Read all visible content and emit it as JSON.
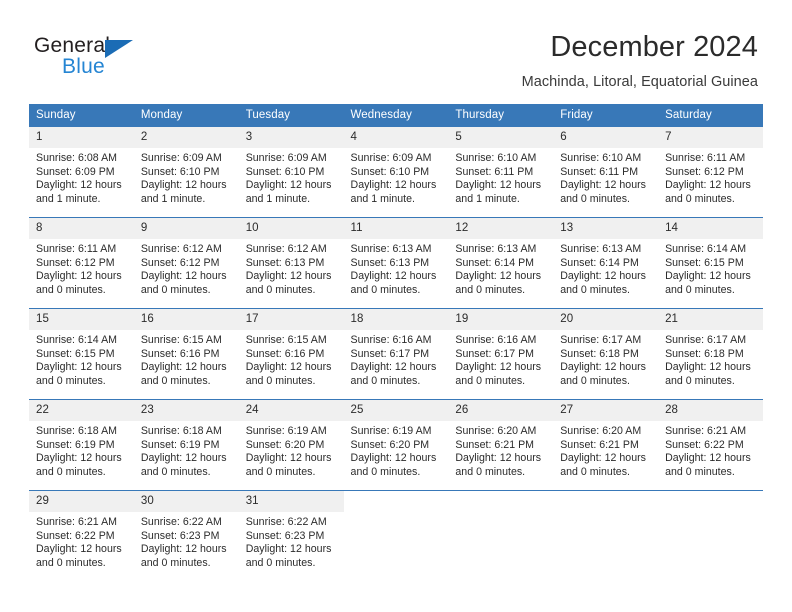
{
  "brand": {
    "name_dark": "General",
    "name_blue": "Blue",
    "accent_color": "#2585d3",
    "triangle_color": "#1b6cb5"
  },
  "header": {
    "title": "December 2024",
    "subtitle": "Machinda, Litoral, Equatorial Guinea"
  },
  "calendar": {
    "header_bg": "#3878b8",
    "daynum_bg": "#f0f0f0",
    "weekday_headers": [
      "Sunday",
      "Monday",
      "Tuesday",
      "Wednesday",
      "Thursday",
      "Friday",
      "Saturday"
    ],
    "weeks": [
      [
        {
          "day": "1",
          "sunrise": "Sunrise: 6:08 AM",
          "sunset": "Sunset: 6:09 PM",
          "daylight_line1": "Daylight: 12 hours",
          "daylight_line2": "and 1 minute."
        },
        {
          "day": "2",
          "sunrise": "Sunrise: 6:09 AM",
          "sunset": "Sunset: 6:10 PM",
          "daylight_line1": "Daylight: 12 hours",
          "daylight_line2": "and 1 minute."
        },
        {
          "day": "3",
          "sunrise": "Sunrise: 6:09 AM",
          "sunset": "Sunset: 6:10 PM",
          "daylight_line1": "Daylight: 12 hours",
          "daylight_line2": "and 1 minute."
        },
        {
          "day": "4",
          "sunrise": "Sunrise: 6:09 AM",
          "sunset": "Sunset: 6:10 PM",
          "daylight_line1": "Daylight: 12 hours",
          "daylight_line2": "and 1 minute."
        },
        {
          "day": "5",
          "sunrise": "Sunrise: 6:10 AM",
          "sunset": "Sunset: 6:11 PM",
          "daylight_line1": "Daylight: 12 hours",
          "daylight_line2": "and 1 minute."
        },
        {
          "day": "6",
          "sunrise": "Sunrise: 6:10 AM",
          "sunset": "Sunset: 6:11 PM",
          "daylight_line1": "Daylight: 12 hours",
          "daylight_line2": "and 0 minutes."
        },
        {
          "day": "7",
          "sunrise": "Sunrise: 6:11 AM",
          "sunset": "Sunset: 6:12 PM",
          "daylight_line1": "Daylight: 12 hours",
          "daylight_line2": "and 0 minutes."
        }
      ],
      [
        {
          "day": "8",
          "sunrise": "Sunrise: 6:11 AM",
          "sunset": "Sunset: 6:12 PM",
          "daylight_line1": "Daylight: 12 hours",
          "daylight_line2": "and 0 minutes."
        },
        {
          "day": "9",
          "sunrise": "Sunrise: 6:12 AM",
          "sunset": "Sunset: 6:12 PM",
          "daylight_line1": "Daylight: 12 hours",
          "daylight_line2": "and 0 minutes."
        },
        {
          "day": "10",
          "sunrise": "Sunrise: 6:12 AM",
          "sunset": "Sunset: 6:13 PM",
          "daylight_line1": "Daylight: 12 hours",
          "daylight_line2": "and 0 minutes."
        },
        {
          "day": "11",
          "sunrise": "Sunrise: 6:13 AM",
          "sunset": "Sunset: 6:13 PM",
          "daylight_line1": "Daylight: 12 hours",
          "daylight_line2": "and 0 minutes."
        },
        {
          "day": "12",
          "sunrise": "Sunrise: 6:13 AM",
          "sunset": "Sunset: 6:14 PM",
          "daylight_line1": "Daylight: 12 hours",
          "daylight_line2": "and 0 minutes."
        },
        {
          "day": "13",
          "sunrise": "Sunrise: 6:13 AM",
          "sunset": "Sunset: 6:14 PM",
          "daylight_line1": "Daylight: 12 hours",
          "daylight_line2": "and 0 minutes."
        },
        {
          "day": "14",
          "sunrise": "Sunrise: 6:14 AM",
          "sunset": "Sunset: 6:15 PM",
          "daylight_line1": "Daylight: 12 hours",
          "daylight_line2": "and 0 minutes."
        }
      ],
      [
        {
          "day": "15",
          "sunrise": "Sunrise: 6:14 AM",
          "sunset": "Sunset: 6:15 PM",
          "daylight_line1": "Daylight: 12 hours",
          "daylight_line2": "and 0 minutes."
        },
        {
          "day": "16",
          "sunrise": "Sunrise: 6:15 AM",
          "sunset": "Sunset: 6:16 PM",
          "daylight_line1": "Daylight: 12 hours",
          "daylight_line2": "and 0 minutes."
        },
        {
          "day": "17",
          "sunrise": "Sunrise: 6:15 AM",
          "sunset": "Sunset: 6:16 PM",
          "daylight_line1": "Daylight: 12 hours",
          "daylight_line2": "and 0 minutes."
        },
        {
          "day": "18",
          "sunrise": "Sunrise: 6:16 AM",
          "sunset": "Sunset: 6:17 PM",
          "daylight_line1": "Daylight: 12 hours",
          "daylight_line2": "and 0 minutes."
        },
        {
          "day": "19",
          "sunrise": "Sunrise: 6:16 AM",
          "sunset": "Sunset: 6:17 PM",
          "daylight_line1": "Daylight: 12 hours",
          "daylight_line2": "and 0 minutes."
        },
        {
          "day": "20",
          "sunrise": "Sunrise: 6:17 AM",
          "sunset": "Sunset: 6:18 PM",
          "daylight_line1": "Daylight: 12 hours",
          "daylight_line2": "and 0 minutes."
        },
        {
          "day": "21",
          "sunrise": "Sunrise: 6:17 AM",
          "sunset": "Sunset: 6:18 PM",
          "daylight_line1": "Daylight: 12 hours",
          "daylight_line2": "and 0 minutes."
        }
      ],
      [
        {
          "day": "22",
          "sunrise": "Sunrise: 6:18 AM",
          "sunset": "Sunset: 6:19 PM",
          "daylight_line1": "Daylight: 12 hours",
          "daylight_line2": "and 0 minutes."
        },
        {
          "day": "23",
          "sunrise": "Sunrise: 6:18 AM",
          "sunset": "Sunset: 6:19 PM",
          "daylight_line1": "Daylight: 12 hours",
          "daylight_line2": "and 0 minutes."
        },
        {
          "day": "24",
          "sunrise": "Sunrise: 6:19 AM",
          "sunset": "Sunset: 6:20 PM",
          "daylight_line1": "Daylight: 12 hours",
          "daylight_line2": "and 0 minutes."
        },
        {
          "day": "25",
          "sunrise": "Sunrise: 6:19 AM",
          "sunset": "Sunset: 6:20 PM",
          "daylight_line1": "Daylight: 12 hours",
          "daylight_line2": "and 0 minutes."
        },
        {
          "day": "26",
          "sunrise": "Sunrise: 6:20 AM",
          "sunset": "Sunset: 6:21 PM",
          "daylight_line1": "Daylight: 12 hours",
          "daylight_line2": "and 0 minutes."
        },
        {
          "day": "27",
          "sunrise": "Sunrise: 6:20 AM",
          "sunset": "Sunset: 6:21 PM",
          "daylight_line1": "Daylight: 12 hours",
          "daylight_line2": "and 0 minutes."
        },
        {
          "day": "28",
          "sunrise": "Sunrise: 6:21 AM",
          "sunset": "Sunset: 6:22 PM",
          "daylight_line1": "Daylight: 12 hours",
          "daylight_line2": "and 0 minutes."
        }
      ],
      [
        {
          "day": "29",
          "sunrise": "Sunrise: 6:21 AM",
          "sunset": "Sunset: 6:22 PM",
          "daylight_line1": "Daylight: 12 hours",
          "daylight_line2": "and 0 minutes."
        },
        {
          "day": "30",
          "sunrise": "Sunrise: 6:22 AM",
          "sunset": "Sunset: 6:23 PM",
          "daylight_line1": "Daylight: 12 hours",
          "daylight_line2": "and 0 minutes."
        },
        {
          "day": "31",
          "sunrise": "Sunrise: 6:22 AM",
          "sunset": "Sunset: 6:23 PM",
          "daylight_line1": "Daylight: 12 hours",
          "daylight_line2": "and 0 minutes."
        },
        {
          "day": "",
          "sunrise": "",
          "sunset": "",
          "daylight_line1": "",
          "daylight_line2": ""
        },
        {
          "day": "",
          "sunrise": "",
          "sunset": "",
          "daylight_line1": "",
          "daylight_line2": ""
        },
        {
          "day": "",
          "sunrise": "",
          "sunset": "",
          "daylight_line1": "",
          "daylight_line2": ""
        },
        {
          "day": "",
          "sunrise": "",
          "sunset": "",
          "daylight_line1": "",
          "daylight_line2": ""
        }
      ]
    ]
  }
}
